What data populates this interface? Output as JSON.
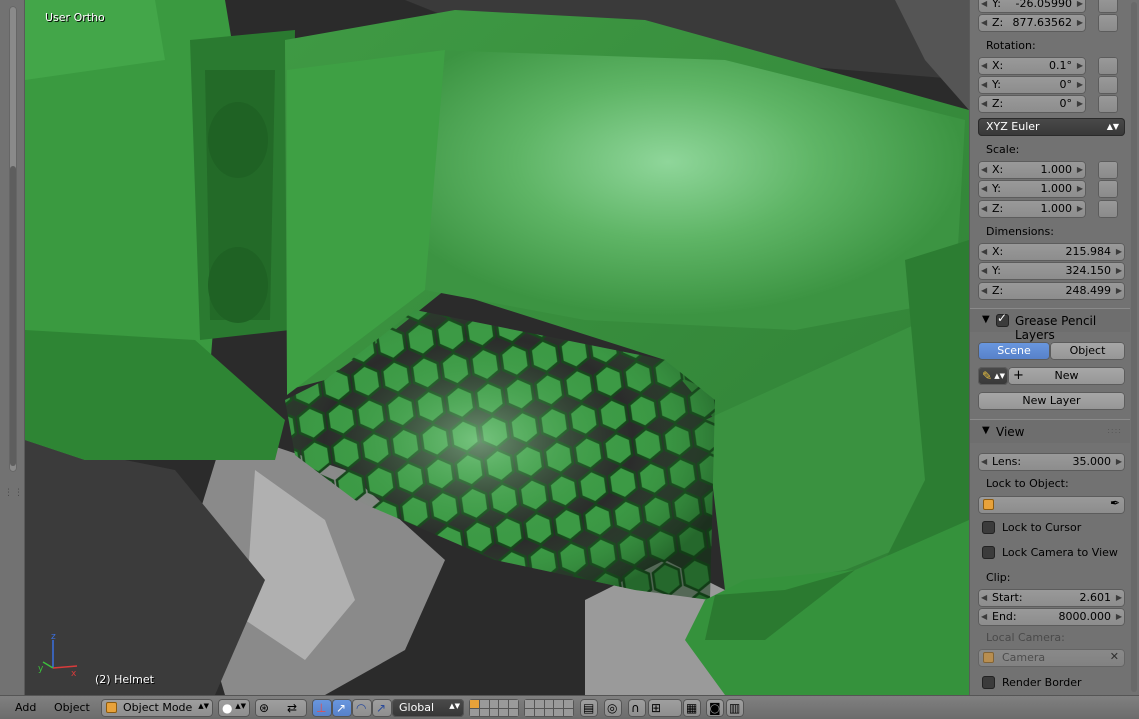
{
  "viewport": {
    "view_label": "User Ortho",
    "object_label": "(2) Helmet"
  },
  "transform": {
    "location": {
      "y_label": "Y:",
      "y_value": "-26.05990",
      "z_label": "Z:",
      "z_value": "877.63562"
    },
    "rotation": {
      "label": "Rotation:",
      "x_label": "X:",
      "x_value": "0.1°",
      "y_label": "Y:",
      "y_value": "0°",
      "z_label": "Z:",
      "z_value": "0°",
      "mode": "XYZ Euler"
    },
    "scale": {
      "label": "Scale:",
      "x_label": "X:",
      "x_value": "1.000",
      "y_label": "Y:",
      "y_value": "1.000",
      "z_label": "Z:",
      "z_value": "1.000"
    },
    "dimensions": {
      "label": "Dimensions:",
      "x_label": "X:",
      "x_value": "215.984",
      "y_label": "Y:",
      "y_value": "324.150",
      "z_label": "Z:",
      "z_value": "248.499"
    }
  },
  "grease_pencil": {
    "title": "Grease Pencil Layers",
    "enabled": true,
    "tab_scene": "Scene",
    "tab_object": "Object",
    "new_label": "New",
    "new_layer_label": "New Layer"
  },
  "view_panel": {
    "title": "View",
    "lens_label": "Lens:",
    "lens_value": "35.000",
    "lock_to_object_label": "Lock to Object:",
    "lock_to_cursor_label": "Lock to Cursor",
    "lock_camera_label": "Lock Camera to View",
    "clip_label": "Clip:",
    "clip_start_label": "Start:",
    "clip_start_value": "2.601",
    "clip_end_label": "End:",
    "clip_end_value": "8000.000",
    "local_camera_label": "Local Camera:",
    "local_camera_value": "Camera",
    "render_border_label": "Render Border"
  },
  "header": {
    "menu_add": "Add",
    "menu_object": "Object",
    "mode": "Object Mode",
    "orientation": "Global"
  },
  "colors": {
    "mesh_green": "#3f9a44",
    "accent_blue": "#5680c8",
    "panel_bg": "#727272"
  }
}
